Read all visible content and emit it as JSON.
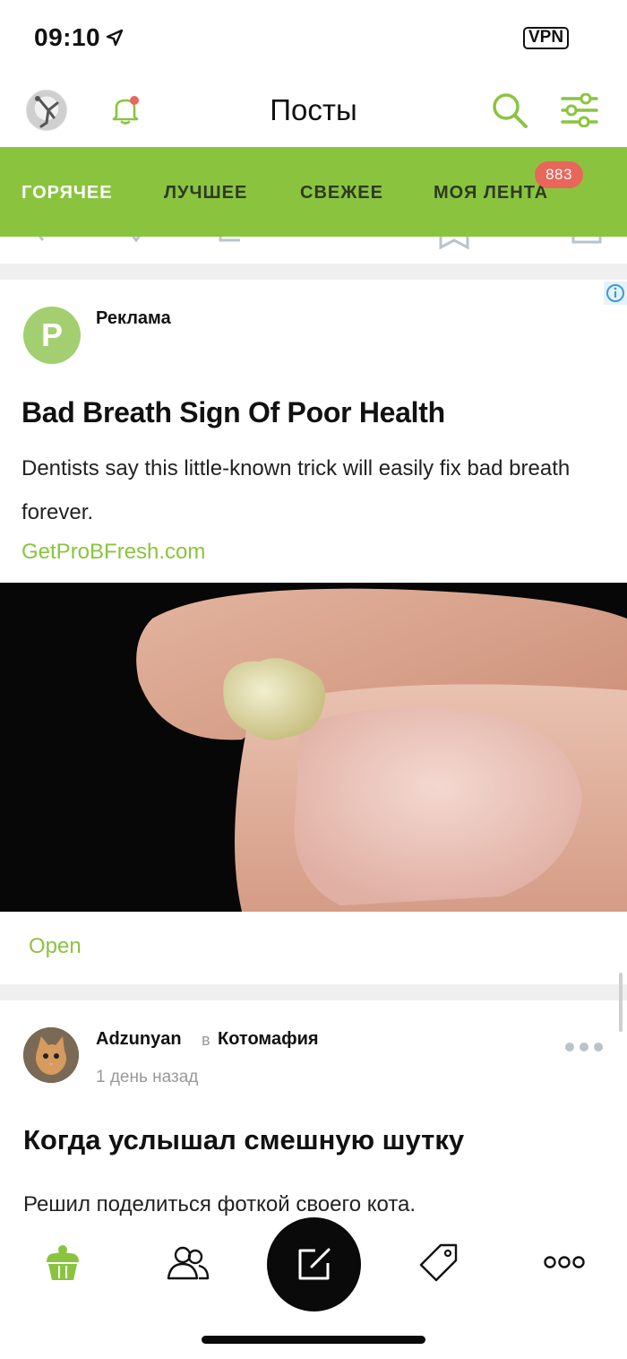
{
  "status_bar": {
    "time": "09:10",
    "vpn": "VPN"
  },
  "header": {
    "title": "Посты",
    "icons": [
      "avatar",
      "bell-icon",
      "search-icon",
      "filter-icon"
    ],
    "notification_dot_color": "#e8665a"
  },
  "tabs": [
    {
      "label": "ГОРЯЧЕЕ",
      "active": true
    },
    {
      "label": "ЛУЧШЕЕ",
      "active": false
    },
    {
      "label": "СВЕЖЕЕ",
      "active": false
    },
    {
      "label": "МОЯ ЛЕНТА",
      "active": false,
      "badge": "883"
    }
  ],
  "ad": {
    "avatar_letter": "P",
    "label": "Реклама",
    "title": "Bad Breath Sign Of Poor Health",
    "description": "Dentists say this little-known trick will easily fix bad breath forever.",
    "link": "GetProBFresh.com",
    "open_label": "Open"
  },
  "post": {
    "author": "Adzunyan",
    "in": "в",
    "community": "Котомафия",
    "time": "1 день назад",
    "title": "Когда услышал смешную шутку",
    "text": "Решил поделиться фоткой своего кота."
  },
  "bottom_nav": {
    "items": [
      "cupcake-icon",
      "community-icon",
      "compose-icon",
      "tag-icon",
      "more-icon"
    ]
  },
  "colors": {
    "accent": "#8ac43f",
    "badge": "#e8665a",
    "text": "#111111",
    "muted": "#999999"
  }
}
